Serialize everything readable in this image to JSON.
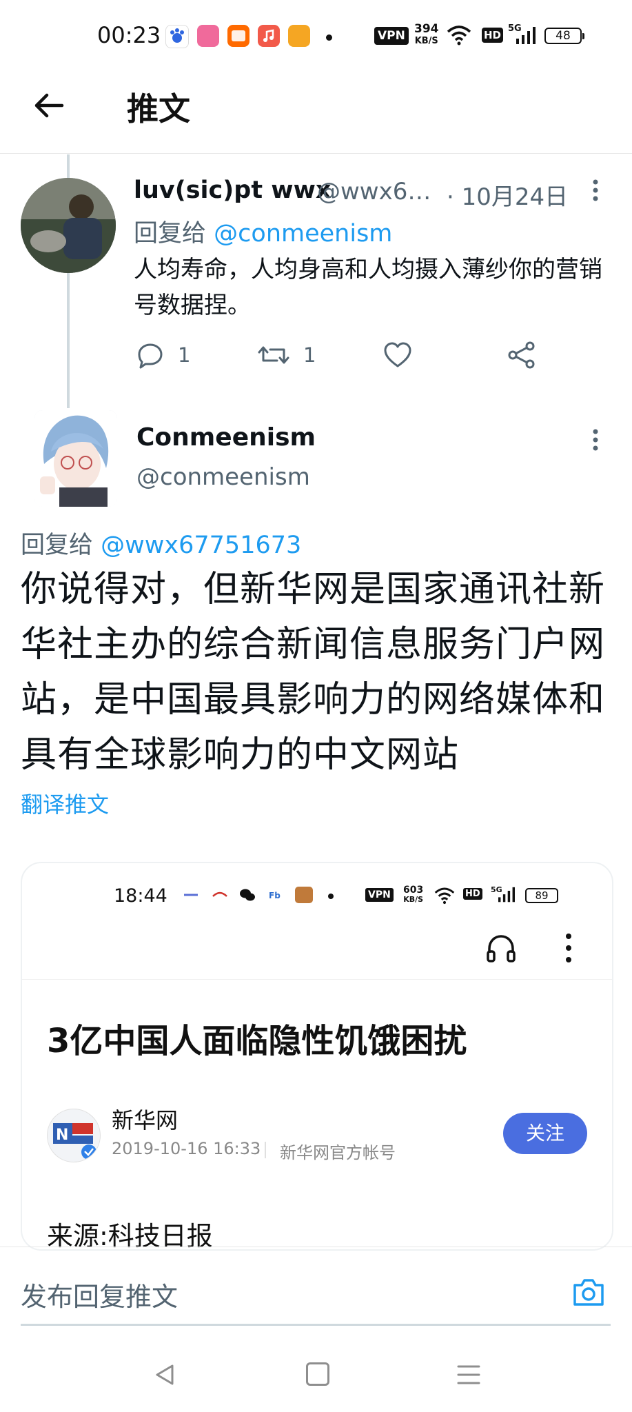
{
  "status_bar": {
    "time": "00:23",
    "vpn": "VPN",
    "speed_value": "394",
    "speed_unit": "KB/S",
    "hd": "HD",
    "network": "5G",
    "battery": "48"
  },
  "header": {
    "title": "推文"
  },
  "tweet_reply": {
    "display_name": "luv(sic)pt wwx",
    "handle": "@wwx6…",
    "date": "· 10月24日",
    "reply_prefix": "回复给",
    "reply_mention": "@conmeenism",
    "text": "人均寿命，人均身高和人均摄入薄纱你的营销号数据捏。",
    "reply_count": "1",
    "retweet_count": "1"
  },
  "tweet_main": {
    "display_name": "Conmeenism",
    "handle": "@conmeenism",
    "reply_prefix": "回复给",
    "reply_mention": "@wwx67751673",
    "text": "你说得对，但新华网是国家通讯社新华社主办的综合新闻信息服务门户网站，是中国最具影响力的网络媒体和具有全球影响力的中文网站",
    "translate": "翻译推文"
  },
  "embedded_screenshot": {
    "time": "18:44",
    "vpn": "VPN",
    "speed_value": "603",
    "speed_unit": "KB/S",
    "hd": "HD",
    "network": "5G",
    "battery": "89",
    "article_title": "3亿中国人面临隐性饥饿困扰",
    "source_name": "新华网",
    "publish_time": "2019-10-16 16:33",
    "account_type": "新华网官方帐号",
    "follow_label": "关注",
    "origin": "来源:科技日报"
  },
  "compose": {
    "placeholder": "发布回复推文"
  },
  "colors": {
    "link": "#1d9bf0",
    "secondary_text": "#536471",
    "follow_button": "#4a6ee0"
  }
}
